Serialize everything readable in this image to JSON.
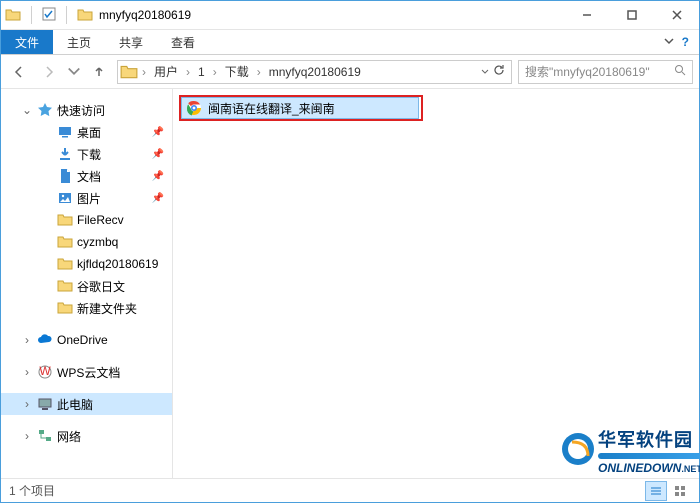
{
  "window": {
    "title": "mnyfyq20180619"
  },
  "ribbon": {
    "file": "文件",
    "tabs": [
      "主页",
      "共享",
      "查看"
    ]
  },
  "breadcrumb": {
    "items": [
      "用户",
      "1",
      "下载",
      "mnyfyq20180619"
    ]
  },
  "search": {
    "placeholder": "搜索\"mnyfyq20180619\""
  },
  "nav": {
    "quick": "快速访问",
    "desktop": "桌面",
    "downloads": "下载",
    "documents": "文档",
    "pictures": "图片",
    "folders": [
      "FileRecv",
      "cyzmbq",
      "kjfldq20180619",
      "谷歌日文",
      "新建文件夹"
    ],
    "onedrive": "OneDrive",
    "wps": "WPS云文档",
    "thispc": "此电脑",
    "network": "网络"
  },
  "files": {
    "items": [
      {
        "name": "闽南语在线翻译_来闽南"
      }
    ]
  },
  "status": {
    "text": "1 个项目"
  },
  "watermark": {
    "cn": "华军软件园",
    "en": "ONLINEDOWN",
    "net": ".NET"
  }
}
